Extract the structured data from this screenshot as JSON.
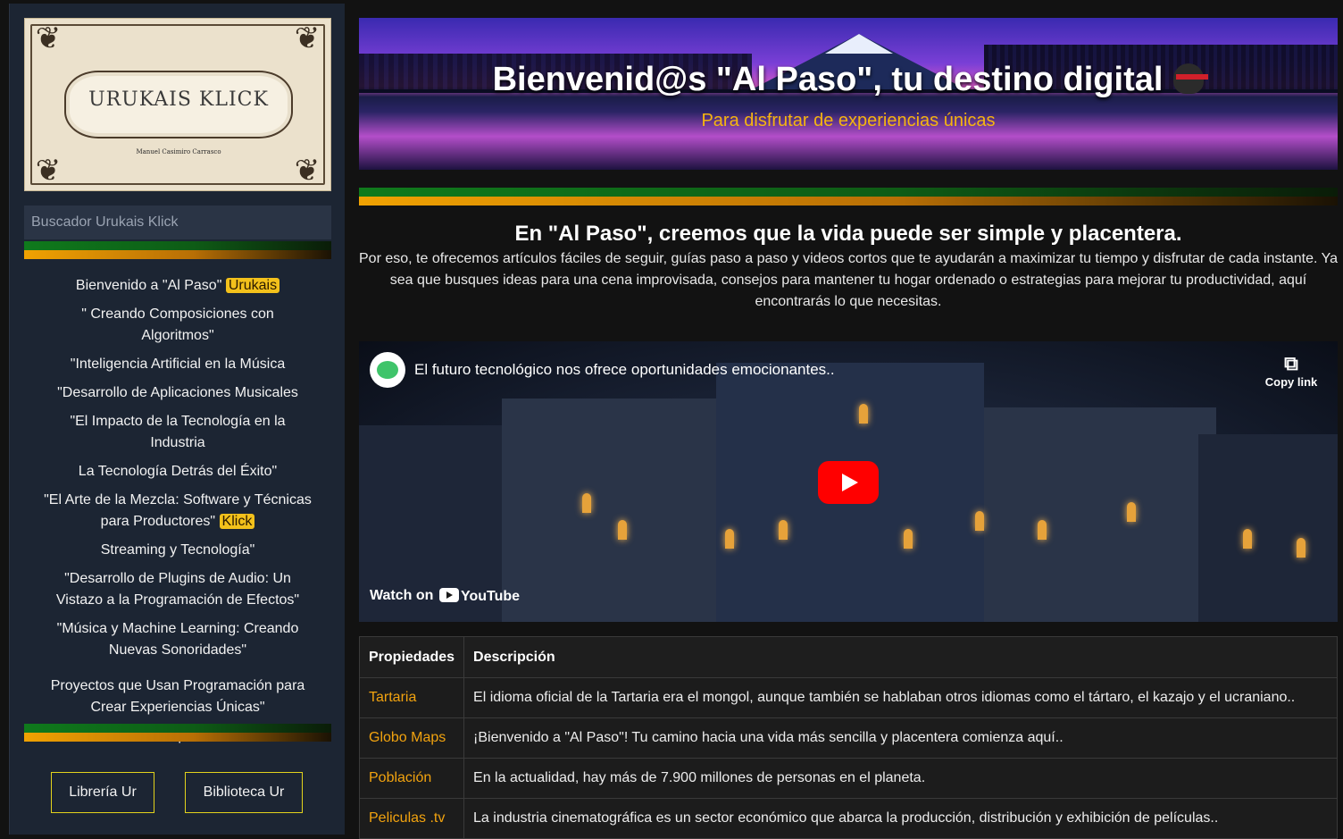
{
  "sidebar": {
    "logo": {
      "title": "URUKAIS KLICK",
      "author": "Manuel Casimiro Carrasco"
    },
    "search": {
      "placeholder": "Buscador Urukais Klick"
    },
    "nav": [
      {
        "label": "Bienvenido a \"Al Paso\"",
        "badge": "Urukais"
      },
      {
        "label": "\" Creando Composiciones con Algoritmos\""
      },
      {
        "label": "\"Inteligencia Artificial en la Música"
      },
      {
        "label": "\"Desarrollo de Aplicaciones Musicales"
      },
      {
        "label": "\"El Impacto de la Tecnología en la Industria"
      },
      {
        "label": "La Tecnología Detrás del Éxito\""
      },
      {
        "label": "\"El Arte de la Mezcla: Software y Técnicas para Productores\"",
        "badge": "Klick"
      },
      {
        "label": "Streaming y Tecnología\""
      },
      {
        "label": "\"Desarrollo de Plugins de Audio: Un Vistazo a la Programación de Efectos\""
      },
      {
        "label": "\"Música y Machine Learning: Creando Nuevas Sonoridades\""
      },
      {
        "label": "Proyectos que Usan Programación para Crear Experiencias Únicas\""
      },
      {
        "label": "Ver listado completo de cursos"
      }
    ],
    "buttons": {
      "libreria": "Librería Ur",
      "biblioteca": "Biblioteca Ur"
    }
  },
  "hero": {
    "title": "Bienvenid@s \"Al Paso\", tu destino digital",
    "subtitle": "Para disfrutar de experiencias únicas"
  },
  "intro": {
    "heading": "En \"Al Paso\", creemos que la vida puede ser simple y placentera.",
    "body": "Por eso, te ofrecemos artículos fáciles de seguir, guías paso a paso y videos cortos que te ayudarán a maximizar tu tiempo y disfrutar de cada instante. Ya sea que busques ideas para una cena improvisada, consejos para mantener tu hogar ordenado o estrategias para mejorar tu productividad, aquí encontrarás lo que necesitas."
  },
  "video": {
    "title": "El futuro tecnológico nos ofrece oportunidades emocionantes..",
    "copy_label": "Copy link",
    "watch_on": "Watch on",
    "youtube": "YouTube"
  },
  "table": {
    "headers": [
      "Propiedades",
      "Descripción"
    ],
    "rows": [
      [
        "Tartaria",
        "El idioma oficial de la Tartaria era el mongol, aunque también se hablaban otros idiomas como el tártaro, el kazajo y el ucraniano.."
      ],
      [
        "Globo Maps",
        "¡Bienvenido a \"Al Paso\"! Tu camino hacia una vida más sencilla y placentera comienza aquí.."
      ],
      [
        "Población",
        "En la actualidad, hay más de 7.900 millones de personas en el planeta."
      ],
      [
        "Peliculas .tv",
        "La industria cinematográfica es un sector económico que abarca la producción, distribución y exhibición de películas.."
      ]
    ]
  },
  "colors": {
    "accent_gold": "#f3c11b",
    "accent_orange": "#f2a30f",
    "stripe_green": "#0f7a1c",
    "sidebar_bg": "#1c2533"
  }
}
